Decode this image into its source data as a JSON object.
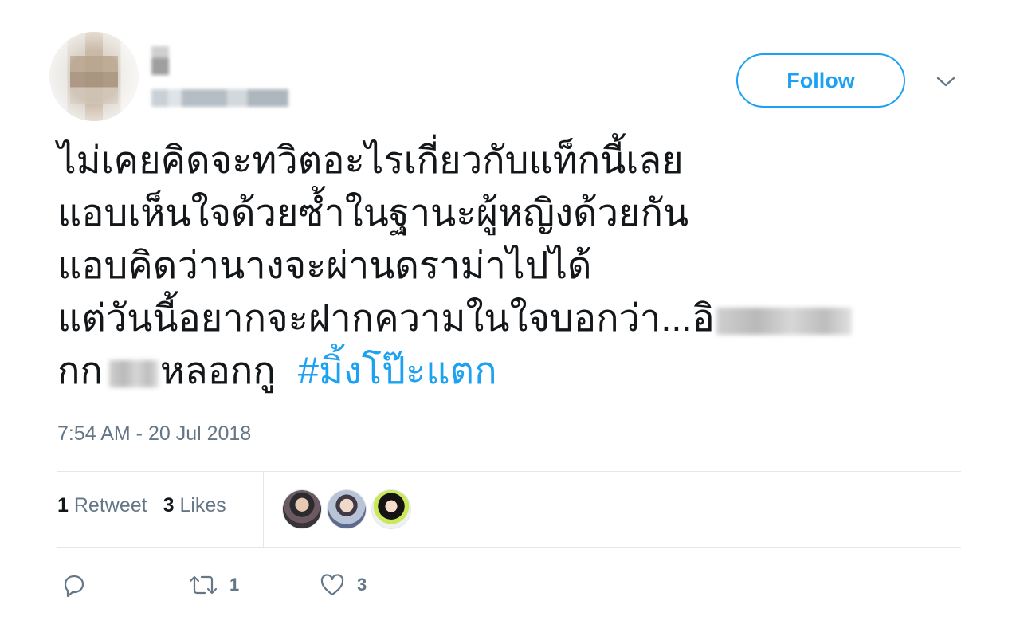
{
  "header": {
    "follow_label": "Follow"
  },
  "tweet": {
    "lines": [
      "ไม่เคยคิดจะทวิตอะไรเกี่ยวกับแท็กนี้เลย",
      "แอบเห็นใจด้วยซ้ำในฐานะผู้หญิงด้วยกัน",
      "แอบคิดว่านางจะผ่านดราม่าไปได้"
    ],
    "line4_prefix": "แต่วันนี้อยากจะฝากความในใจบอกว่า...อิ",
    "line5_start": "กก",
    "line5_mid": "หลอกกู",
    "hashtag": "#มิ้งโป๊ะแตก"
  },
  "timestamp": "7:54 AM - 20 Jul 2018",
  "stats": {
    "retweets_count": "1",
    "retweets_label": "Retweet",
    "likes_count": "3",
    "likes_label": "Likes"
  },
  "actions": {
    "retweet_count": "1",
    "like_count": "3"
  },
  "icons": {
    "reply": "reply-icon",
    "retweet": "retweet-icon",
    "like": "heart-icon",
    "caret": "chevron-down-icon"
  },
  "colors": {
    "accent": "#1da1f2",
    "text": "#14171a",
    "secondary": "#657786",
    "divider": "#e1e8ed"
  }
}
